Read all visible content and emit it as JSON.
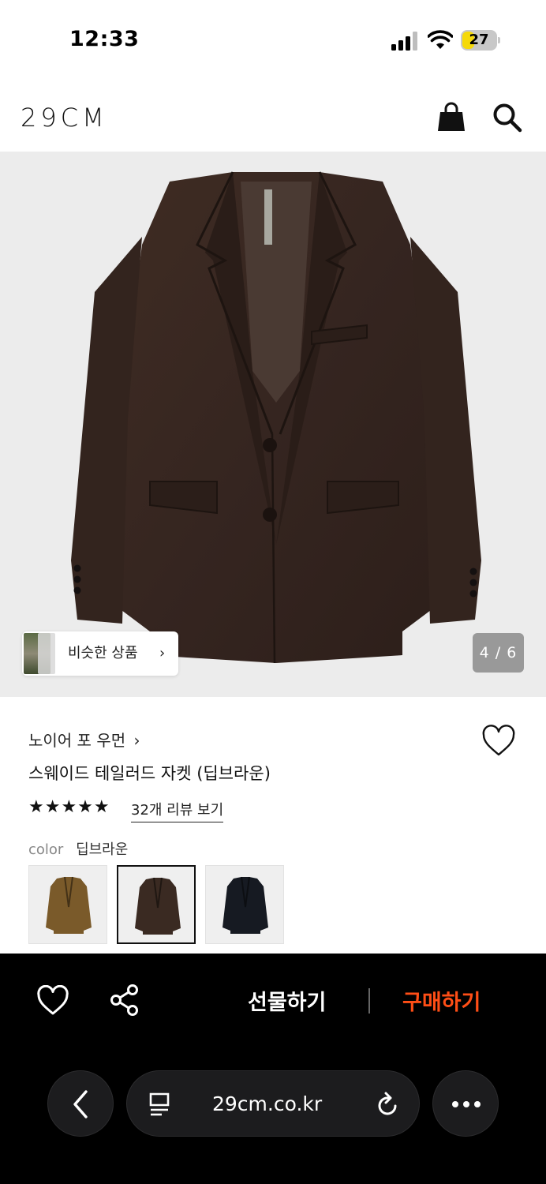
{
  "status_bar": {
    "time": "12:33",
    "battery": "27",
    "battery_level": 0.27
  },
  "header": {
    "logo": "29CM",
    "icons": [
      "shopping-bag-icon",
      "search-icon"
    ]
  },
  "gallery": {
    "similar_label": "비슷한 상품",
    "similar_chevron": "›",
    "counter": "4 / 6"
  },
  "product": {
    "brand": "노이어 포 우먼",
    "brand_chevron": "›",
    "name": "스웨이드 테일러드 자켓 (딥브라운)",
    "stars": "★★★★★",
    "rating": 5,
    "review_link": "32개 리뷰 보기",
    "color_label": "color",
    "color_value": "딥브라운",
    "swatches": [
      {
        "color": "#7a5a2a",
        "selected": false
      },
      {
        "color": "#3a2a22",
        "selected": true
      },
      {
        "color": "#161a22",
        "selected": false
      }
    ]
  },
  "action_bar": {
    "gift_label": "선물하기",
    "buy_label": "구매하기",
    "buy_color": "#ff4e16"
  },
  "browser": {
    "url": "29cm.co.kr"
  }
}
